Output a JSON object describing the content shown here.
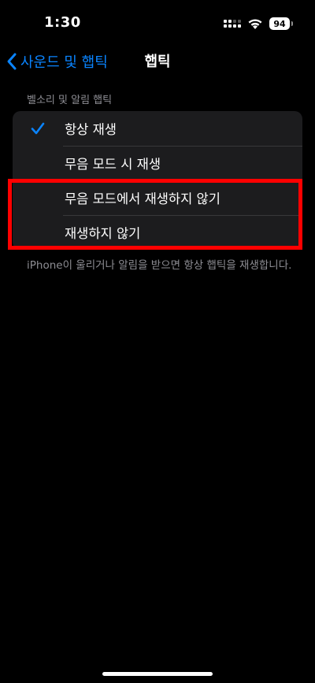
{
  "status_bar": {
    "time": "1:30",
    "battery": "94"
  },
  "nav": {
    "back_label": "사운드 및 햅틱",
    "title": "햅틱"
  },
  "section": {
    "header": "벨소리 및 알림 햅틱",
    "footer": "iPhone이 울리거나 알림을 받으면 항상 햅틱을 재생합니다."
  },
  "options": [
    {
      "label": "항상 재생",
      "selected": true
    },
    {
      "label": "무음 모드 시 재생",
      "selected": false
    },
    {
      "label": "무음 모드에서 재생하지 않기",
      "selected": false
    },
    {
      "label": "재생하지 않기",
      "selected": false
    }
  ],
  "colors": {
    "accent": "#0a84ff",
    "highlight": "#ff0000",
    "cell_background": "#1c1c1e"
  }
}
